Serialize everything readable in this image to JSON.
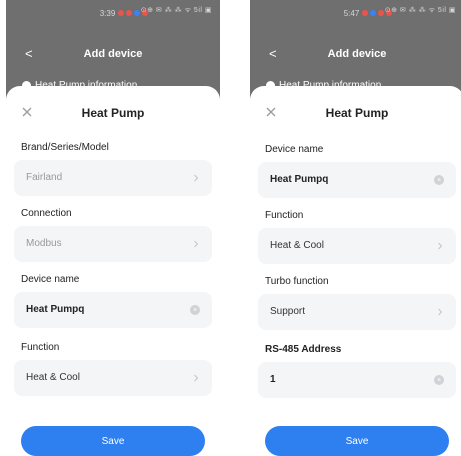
{
  "left": {
    "status": {
      "time": "3:39",
      "right": "⊙⊕ ✉ ⁂ ⁂ ᯤ 5il ▣"
    },
    "header": {
      "back": "<",
      "title": "Add device",
      "peek": "Heat Pump information"
    },
    "sheet": {
      "close": "×",
      "title": "Heat Pump",
      "fields": [
        {
          "label": "Brand/Series/Model",
          "value": "Fairland"
        },
        {
          "label": "Connection",
          "value": "Modbus"
        },
        {
          "label": "Device name",
          "value": "Heat Pumpq"
        },
        {
          "label": "Function",
          "value": "Heat & Cool"
        }
      ],
      "save_label": "Save"
    }
  },
  "right": {
    "status": {
      "time": "5:47",
      "right": "⊙⊕ ✉ ⁂ ⁂ ᯤ 5il ▣"
    },
    "header": {
      "back": "<",
      "title": "Add device",
      "peek": "Heat Pump information"
    },
    "sheet": {
      "close": "×",
      "title": "Heat Pump",
      "fields": [
        {
          "label": "Device name",
          "value": "Heat Pumpq"
        },
        {
          "label": "Function",
          "value": "Heat & Cool"
        },
        {
          "label": "Turbo function",
          "value": "Support"
        },
        {
          "label": "RS-485 Address",
          "value": "1"
        }
      ],
      "save_label": "Save"
    }
  },
  "colors": {
    "accent": "#2e7ff0",
    "field_bg": "#f4f5f7",
    "overlay": "#6f6f6f",
    "status_dot_red": "#e9554b",
    "status_dot_blue": "#3b82f6"
  },
  "icons": {
    "close": "close-icon",
    "chevron": "chevron-right-icon",
    "clear": "clear-input-icon",
    "back": "back-arrow-icon"
  }
}
